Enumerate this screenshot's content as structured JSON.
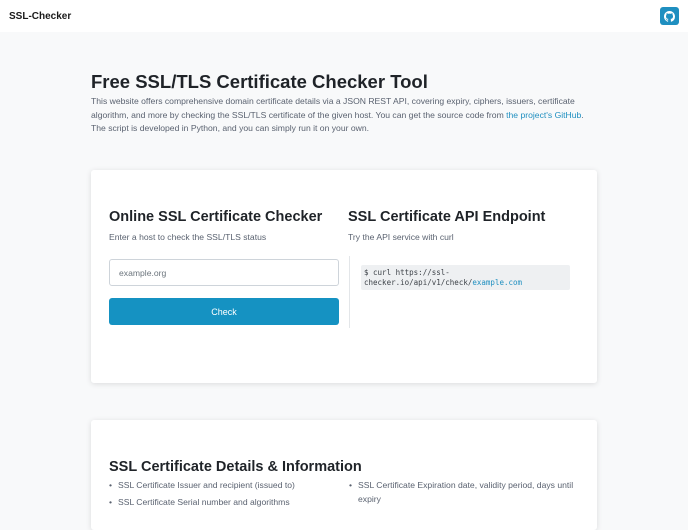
{
  "header": {
    "brand": "SSL-Checker",
    "github_icon": "github-icon",
    "accent": "#1f8fc0"
  },
  "hero": {
    "title": "Free SSL/TLS Certificate Checker Tool",
    "desc_before_link": "This website offers comprehensive domain certificate details via a JSON REST API, covering expiry, ciphers, issuers, certificate algorithm, and more by checking the SSL/TLS certificate of the given host. You can get the source code from ",
    "link_text": "the project's GitHub",
    "desc_after_link": ". The script is developed in Python, and you can simply run it on your own."
  },
  "checker": {
    "title": "Online SSL Certificate Checker",
    "subtitle": "Enter a host to check the SSL/TLS status",
    "input_value": "",
    "input_placeholder": "example.org",
    "button_label": "Check",
    "button_color": "#1592c2"
  },
  "api": {
    "title": "SSL Certificate API Endpoint",
    "subtitle": "Try the API service with curl",
    "code_prefix": "$ curl https://ssl-checker.io/api/v1/check/",
    "code_host": "example.com"
  },
  "details": {
    "title": "SSL Certificate Details & Information",
    "left_items": [
      "SSL Certificate Issuer and recipient (issued to)",
      "SSL Certificate Serial number and algorithms"
    ],
    "right_items": [
      "SSL Certificate Expiration date, validity period, days until expiry"
    ]
  }
}
